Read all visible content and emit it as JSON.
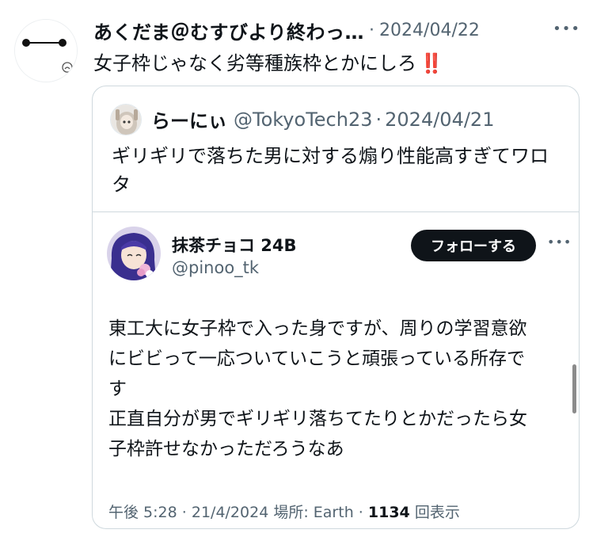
{
  "tweet": {
    "display_name": "あくだま＠むすびより終わっ…",
    "date": "2024/04/22",
    "text": "女子枠じゃなく劣等種族枠とかにしろ",
    "emoji": "‼️",
    "more": "•••"
  },
  "quote": {
    "display_name": "らーにぃ",
    "handle": "@TokyoTech23",
    "date": "2024/04/21",
    "text": "ギリギリで落ちた男に対する煽り性能高すぎてワロタ"
  },
  "nested_quote": {
    "display_name": "抹茶チョコ 24B",
    "handle": "@pinoo_tk",
    "follow_label": "フォローする",
    "more": "•••",
    "lines": [
      "東工大に女子枠で入った身ですが、周りの学習意欲",
      "にビビって一応ついていこうと頑張っている所存で",
      "す",
      "正直自分が男でギリギリ落ちてたりとかだったら女",
      "子枠許せなかっただろうなあ"
    ],
    "footer": {
      "time": "午後 5:28",
      "date": "21/4/2024",
      "location_label": "場所:",
      "location": "Earth",
      "views": "1134",
      "views_label": "回表示"
    }
  },
  "colors": {
    "text": "#0f1419",
    "muted": "#536471",
    "border": "#cfd9de",
    "button_bg": "#0f1419",
    "emoji_red": "#e0162b"
  }
}
